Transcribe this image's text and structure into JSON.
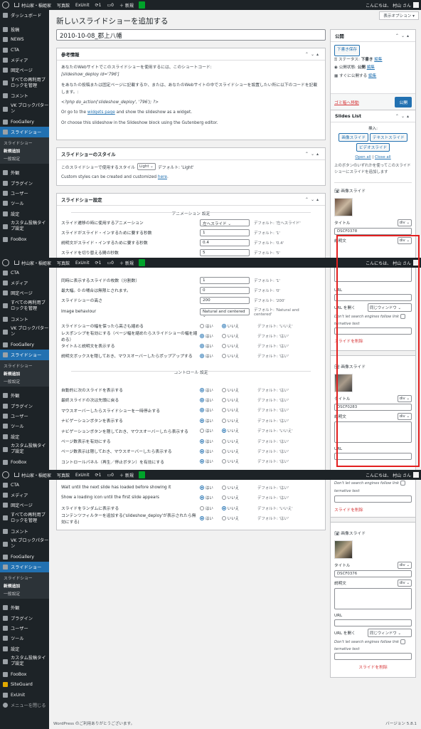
{
  "adminbar": {
    "site": "村山家・稲姫家",
    "items": [
      "写真館",
      "ExUnit"
    ],
    "updates": "1",
    "comments": "0",
    "new": "＋ 新規",
    "greeting": "こんにちは、 村山 さん"
  },
  "sidebar": {
    "dashboard": "ダッシュボード",
    "items_a": [
      "投稿",
      "NEWS",
      "CTA",
      "メディア",
      "固定ページ"
    ],
    "sub_item": "すべての再利用ブロックを管理",
    "comment": "コメント",
    "vk": "VK ブロックパターン",
    "foo": "FooGallery",
    "slideshow": "スライドショー",
    "submenu": [
      "スライドショー",
      "新規追加",
      "一般設定"
    ],
    "appearance": "外観",
    "plugins": "プラグイン",
    "users": "ユーザー",
    "tools": "ツール",
    "settings": "設定",
    "custom": "カスタム投稿タイプ設定",
    "foobox": "FooBox",
    "siteguard": "SiteGuard",
    "exunit": "ExUnit",
    "close": "メニューを閉じる"
  },
  "page": {
    "title": "新しいスライドショーを追加する",
    "screen_options": "表示オプション ▾",
    "post_title": "2010-10-08_郡上八幡"
  },
  "info": {
    "heading": "参考情報",
    "p1": "あなたのWebサイトでこのスライドショーを使用するには、このショートコード:",
    "shortcode": "[slideshow_deploy id='796']",
    "p2": "をあなたの投稿または固定ページに記載するか、または、あなたのWebサイトの中でスライドショーを設置したい所に以下のコードを記載します。:",
    "php": "<?php do_action('slideshow_deploy', '796'); ?>",
    "p3a": "Or go to the ",
    "widgets": "widgets page",
    "p3b": " and show the slideshow as a widget.",
    "p4": "Or choose this slideshow in the Slideshow block using the Gutenberg editor."
  },
  "style": {
    "heading": "スライドショーのスタイル",
    "label": "このスライドショーで使用するスタイル",
    "value": "Light",
    "default": "デフォルト: 'Light'",
    "custom": "Custom styles can be created and customized ",
    "here": "here"
  },
  "settings": {
    "heading": "スライドショー設定",
    "anim": "アニメーション 設定",
    "rows1": [
      [
        "スライド遷移の時に使用するアニメーション",
        "左へスライド",
        "デフォルト: '左へスライド'"
      ],
      [
        "スライドがスライド・インするために要する秒数",
        "1",
        "デフォルト: '1'"
      ],
      [
        "説明文がスライド・インするために要する秒数",
        "0.4",
        "デフォルト: '0.4'"
      ],
      [
        "スライドを切り替える間の秒数",
        "5",
        "デフォルト: '5'"
      ]
    ],
    "rows2": [
      [
        "同時に表示するスライドの枚数（分割数）",
        "1",
        "デフォルト: '1'"
      ],
      [
        "最大幅。0 の場合は無限とされます。",
        "0",
        "デフォルト: '0'"
      ],
      [
        "スライドショーの高さ",
        "200",
        "デフォルト: '200'"
      ],
      [
        "Image behaviour",
        "Natural and centered",
        "デフォルト: 'Natural and centered'"
      ]
    ],
    "radios1": [
      [
        "スライドショーの幅を保ったら高さも縮める",
        false,
        "デフォルト: 'いいえ'"
      ],
      [
        "レスポンシブを有効にする（ページ幅を縮めたらスライドショーの幅を縮める）",
        true,
        "デフォルト: 'はい'"
      ],
      [
        "タイトルと説明文を表示する",
        true,
        "デフォルト: 'はい'"
      ],
      [
        "説明文ボックスを隠しておき、マウスオーバーしたらポップアップする",
        true,
        "デフォルト: 'はい'"
      ]
    ],
    "ctrl": "コントロール 設定",
    "radios2": [
      [
        "自動的に次のスライドを表示する",
        true,
        "デフォルト: 'はい'"
      ],
      [
        "最終スライドの次は先頭に戻る",
        true,
        "デフォルト: 'はい'"
      ],
      [
        "マウスオーバーしたらスライドショーを一時停止する",
        true,
        "デフォルト: 'はい'"
      ],
      [
        "ナビゲーションボタンを表示する",
        true,
        "デフォルト: 'はい'"
      ],
      [
        "ナビゲーションボタンを隠しておき、マウスオーバーしたら表示する",
        false,
        "デフォルト: 'いいえ'"
      ],
      [
        "ページ数表示を有効にする",
        true,
        "デフォルト: 'はい'"
      ],
      [
        "ページ数表示は隠しておき、マウスオーバーしたら表示する",
        true,
        "デフォルト: 'はい'"
      ],
      [
        "コントロールパネル（再生／停止ボタン）を有効にする",
        true,
        "デフォルト: 'はい'"
      ]
    ],
    "radios3": [
      [
        "Wait until the next slide has loaded before showing it",
        true,
        "デフォルト: 'はい'"
      ],
      [
        "Show a loading icon until the first slide appears",
        true,
        "デフォルト: 'はい'"
      ],
      [
        "スライドをランダムに表示する",
        false,
        "デフォルト: 'いいえ'"
      ],
      [
        "コンテンツフィルターを追加する('slideshow_deploy'が表示されたら無効にする)",
        true,
        "デフォルト: 'はい'"
      ]
    ],
    "yes": "はい",
    "no": "いいえ"
  },
  "publish": {
    "heading": "公開",
    "save": "下書き保存",
    "status_label": "ステータス: ",
    "status": "下書き",
    "edit": "編集",
    "vis_label": "公開状態: ",
    "vis": "公開",
    "sched": "すぐに公開する",
    "trash": "ゴミ箱へ移動",
    "publish": "公開"
  },
  "slides": {
    "heading": "Slides List",
    "insert": "挿入:",
    "b1": "画像スライド",
    "b2": "テキストスライド",
    "b3": "ビデオスライド",
    "open": "Open all",
    "close": "Close all",
    "note": "上のボタンのいずれかを使ってこのスライドショーにスライドを追加します",
    "item_title": "画像スライド",
    "title_label": "タイトル",
    "desc_label": "説明文",
    "url_label": "URL",
    "open_label": "URL を開く",
    "open_val": "同じウィンドウ",
    "nofollow": "Don't let search engines follow link",
    "alt": "ternative text",
    "del": "スライドを削除",
    "div": "div",
    "titles": [
      "DSCF0378",
      "DSCF0283",
      "DSCF0376"
    ]
  },
  "footer": {
    "left": "WordPress のご利用ありがとうございます。",
    "wp": "WordPress",
    "right": "バージョン 5.8.1"
  }
}
